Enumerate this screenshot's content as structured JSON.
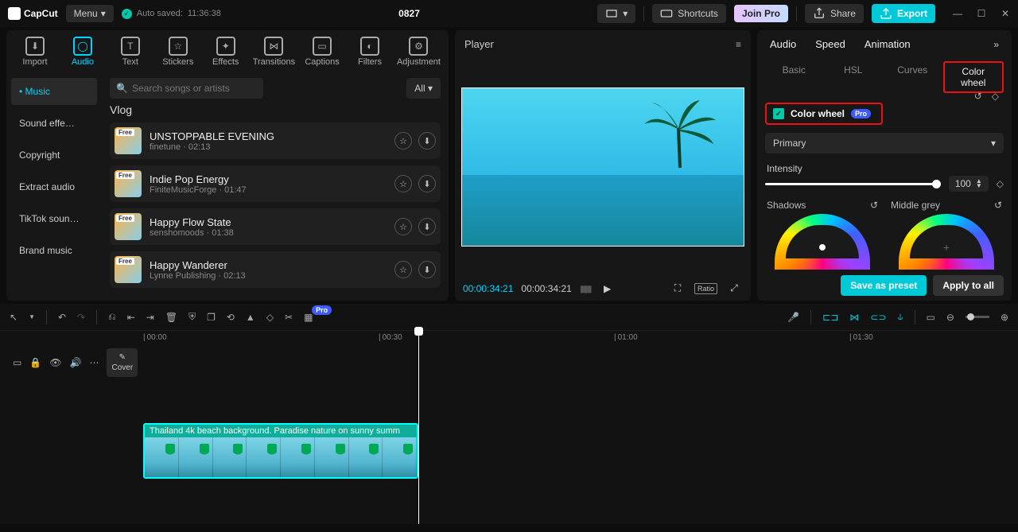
{
  "titlebar": {
    "brand": "CapCut",
    "menu": "Menu",
    "autosaved_prefix": "Auto saved:",
    "autosaved_time": "11:36:38",
    "project": "0827",
    "shortcuts": "Shortcuts",
    "join": "Join Pro",
    "share": "Share",
    "export": "Export"
  },
  "left_tabs": [
    "Import",
    "Audio",
    "Text",
    "Stickers",
    "Effects",
    "Transitions",
    "Captions",
    "Filters",
    "Adjustment"
  ],
  "left_tabs_active_index": 1,
  "categories": [
    "Music",
    "Sound effe…",
    "Copyright",
    "Extract audio",
    "TikTok soun…",
    "Brand music"
  ],
  "categories_active_index": 0,
  "search_placeholder": "Search songs or artists",
  "all_label": "All ▾",
  "section_title": "Vlog",
  "tracks": [
    {
      "title": "UNSTOPPABLE EVENING",
      "artist": "finetune",
      "dur": "02:13",
      "free": "Free"
    },
    {
      "title": "Indie Pop Energy",
      "artist": "FiniteMusicForge",
      "dur": "01:47",
      "free": "Free"
    },
    {
      "title": "Happy Flow State",
      "artist": "senshomoods",
      "dur": "01:38",
      "free": "Free"
    },
    {
      "title": "Happy Wanderer",
      "artist": "Lynne Publishing",
      "dur": "02:13",
      "free": "Free"
    }
  ],
  "player": {
    "title": "Player",
    "tc1": "00:00:34:21",
    "tc2": "00:00:34:21",
    "ratio": "Ratio"
  },
  "right": {
    "tabs": [
      "Audio",
      "Speed",
      "Animation"
    ],
    "subtabs": [
      "Basic",
      "HSL",
      "Curves",
      "Color wheel"
    ],
    "subtab_active_index": 3,
    "cw_label": "Color wheel",
    "pro": "Pro",
    "primary": "Primary",
    "intensity_label": "Intensity",
    "intensity_value": "100",
    "wheel1": "Shadows",
    "wheel2": "Middle grey",
    "save_preset": "Save as preset",
    "apply_all": "Apply to all"
  },
  "timeline": {
    "marks": [
      "00:00",
      "00:30",
      "01:00",
      "01:30"
    ],
    "clip_title": "Thailand 4k beach background. Paradise nature on sunny summ",
    "cover": "Cover",
    "pro_badge": "Pro"
  }
}
